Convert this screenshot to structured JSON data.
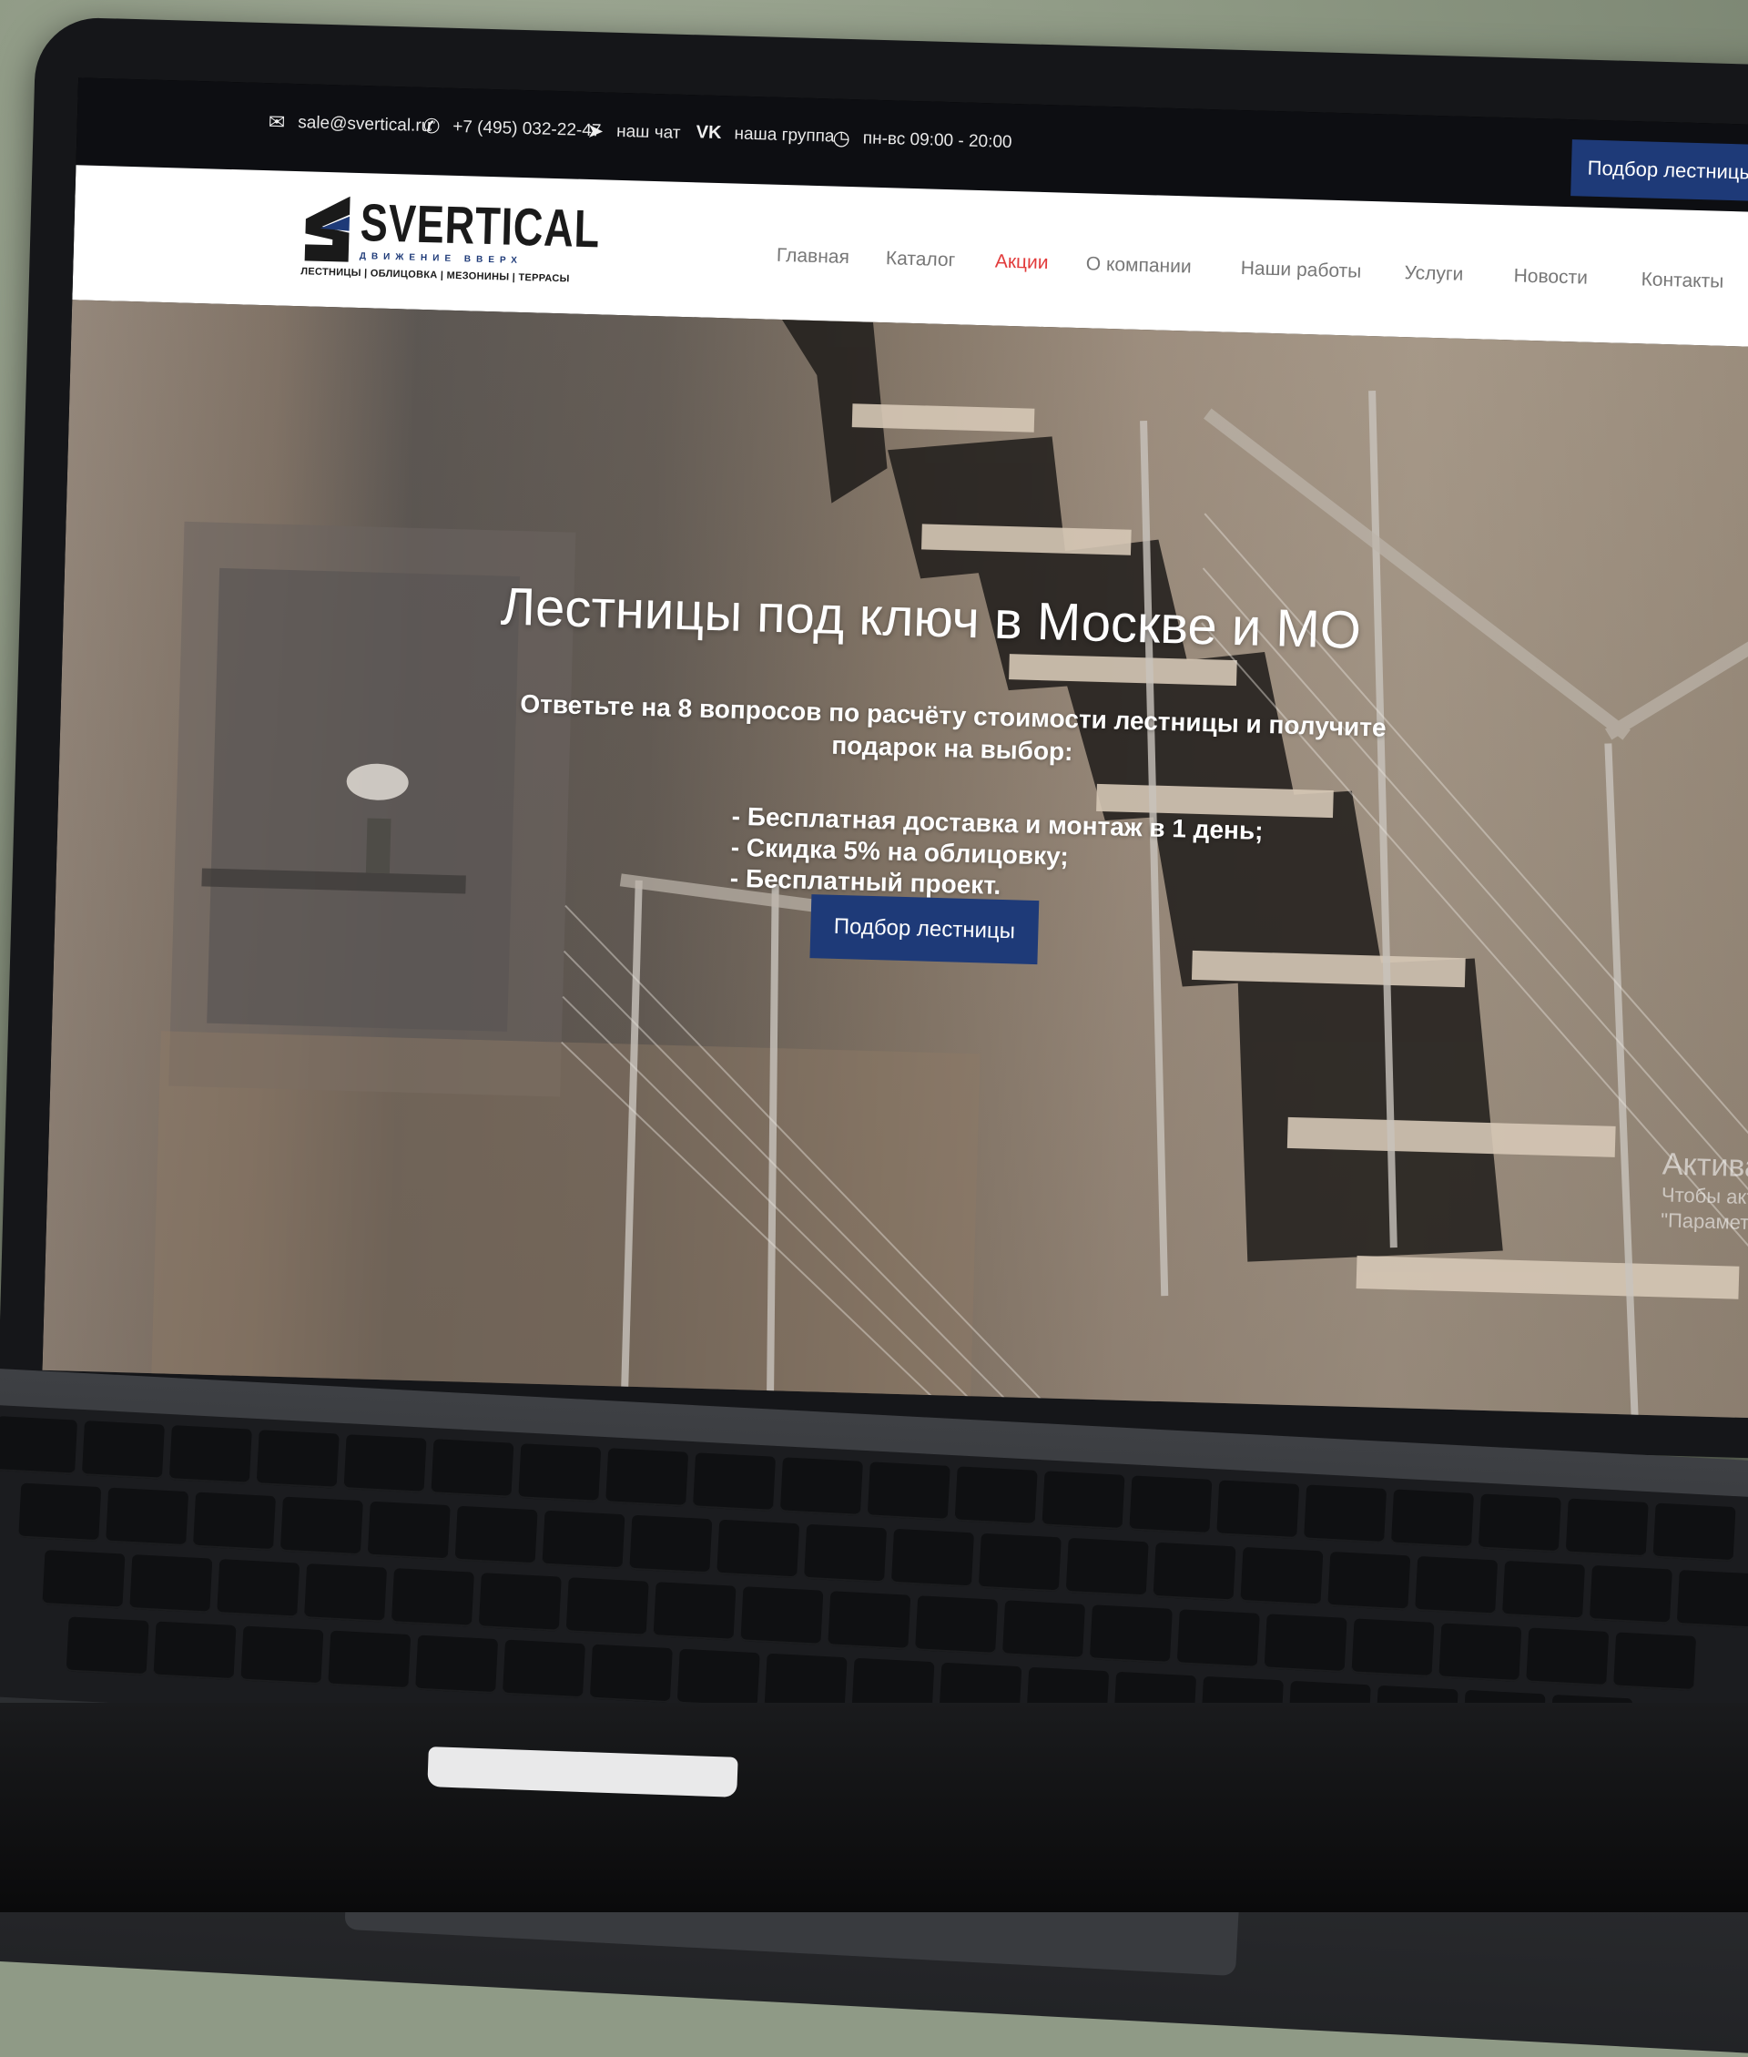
{
  "topbar": {
    "email": "sale@svertical.ru",
    "phone": "+7 (495) 032-22-47",
    "chat": "наш чат",
    "group": "наша группа",
    "hours": "пн-вс 09:00 - 20:00",
    "cta": "Подбор лестницы",
    "icons": [
      "mail-icon",
      "phone-icon",
      "telegram-icon",
      "vk-icon",
      "clock-icon"
    ]
  },
  "logo": {
    "name": "SVERTICAL",
    "tagline": "ДВИЖЕНИЕ ВВЕРХ",
    "services": "ЛЕСТНИЦЫ | ОБЛИЦОВКА | МЕЗОНИНЫ | ТЕРРАСЫ"
  },
  "nav": {
    "items": [
      "Главная",
      "Каталог",
      "Акции",
      "О компании",
      "Наши работы",
      "Услуги",
      "Новости",
      "Контакты"
    ],
    "active_index": 2
  },
  "hero": {
    "title": "Лестницы под ключ в Москве и МО",
    "subtitle": "Ответьте на 8 вопросов по расчёту стоимости лестницы и получите подарок на выбор:",
    "benefits": [
      "- Бесплатная доставка и монтаж в 1 день;",
      "- Скидка 5% на облицовку;",
      "- Бесплатный проект."
    ],
    "cta": "Подбор лестницы"
  },
  "watermark": {
    "title": "Активаци",
    "line1": "Чтобы активи",
    "line2": "\"Параметры\""
  },
  "colors": {
    "brand_blue": "#1e3a78",
    "active_nav": "#e23b3b",
    "topbar_bg": "#0d0e12"
  }
}
